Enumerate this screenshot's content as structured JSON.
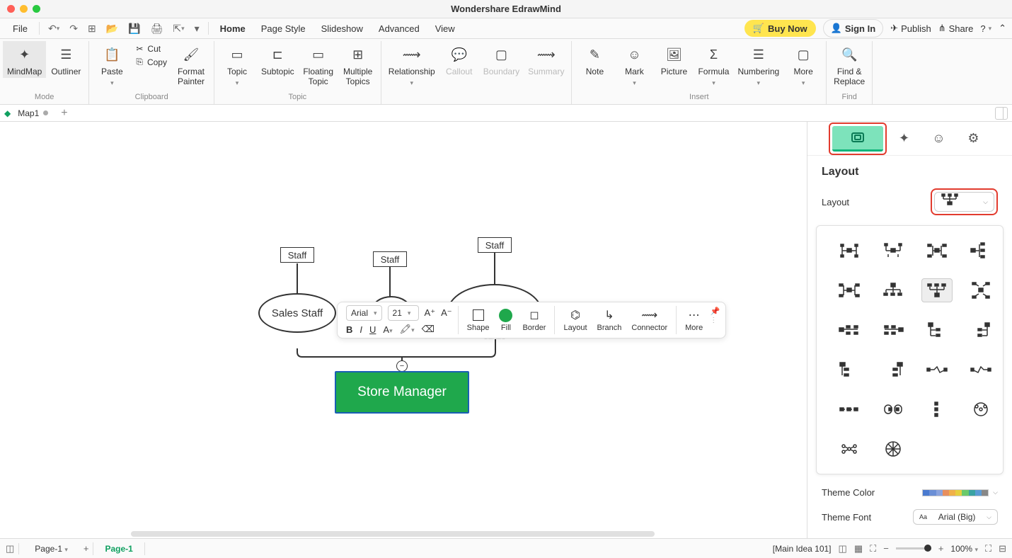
{
  "app": {
    "title": "Wondershare EdrawMind"
  },
  "menubar": {
    "file": "File",
    "tabs": [
      "Home",
      "Page Style",
      "Slideshow",
      "Advanced",
      "View"
    ],
    "active_tab": "Home",
    "buy_now": "Buy Now",
    "sign_in": "Sign In",
    "publish": "Publish",
    "share": "Share"
  },
  "ribbon": {
    "mode": {
      "mindmap": "MindMap",
      "outliner": "Outliner",
      "label": "Mode"
    },
    "clipboard": {
      "paste": "Paste",
      "cut": "Cut",
      "copy": "Copy",
      "format_painter": "Format\nPainter",
      "label": "Clipboard"
    },
    "topic": {
      "topic": "Topic",
      "subtopic": "Subtopic",
      "floating": "Floating\nTopic",
      "multiple": "Multiple\nTopics",
      "label": "Topic"
    },
    "structure": {
      "relationship": "Relationship",
      "callout": "Callout",
      "boundary": "Boundary",
      "summary": "Summary"
    },
    "insert": {
      "note": "Note",
      "mark": "Mark",
      "picture": "Picture",
      "formula": "Formula",
      "numbering": "Numbering",
      "more": "More",
      "label": "Insert"
    },
    "find": {
      "find_replace": "Find &\nReplace",
      "label": "Find"
    }
  },
  "doc_tab": {
    "name": "Map1"
  },
  "canvas": {
    "nodes": {
      "staff1": "Staff",
      "staff2": "Staff",
      "staff3": "Staff",
      "sales_staff": "Sales Staff",
      "store_manager": "Store Manager"
    },
    "collapse": "−"
  },
  "float_toolbar": {
    "font": "Arial",
    "size": "21",
    "bold": "B",
    "italic": "I",
    "underline": "U",
    "shape": "Shape",
    "fill": "Fill",
    "border": "Border",
    "layout": "Layout",
    "branch": "Branch",
    "connector": "Connector",
    "more": "More"
  },
  "right_panel": {
    "section_title": "Layout",
    "layout_label": "Layout",
    "theme_color": "Theme Color",
    "theme_font": "Theme Font",
    "font_value": "Arial (Big)",
    "colors": [
      "#4a7bd0",
      "#6b8fd6",
      "#8ba3dd",
      "#e88f5e",
      "#f0b04a",
      "#e6cf3f",
      "#6bc96b",
      "#3aa3a3",
      "#5b9bd5",
      "#888"
    ]
  },
  "statusbar": {
    "page_sel": "Page-1",
    "page_active": "Page-1",
    "main_idea": "[Main Idea 101]",
    "zoom": "100%"
  }
}
